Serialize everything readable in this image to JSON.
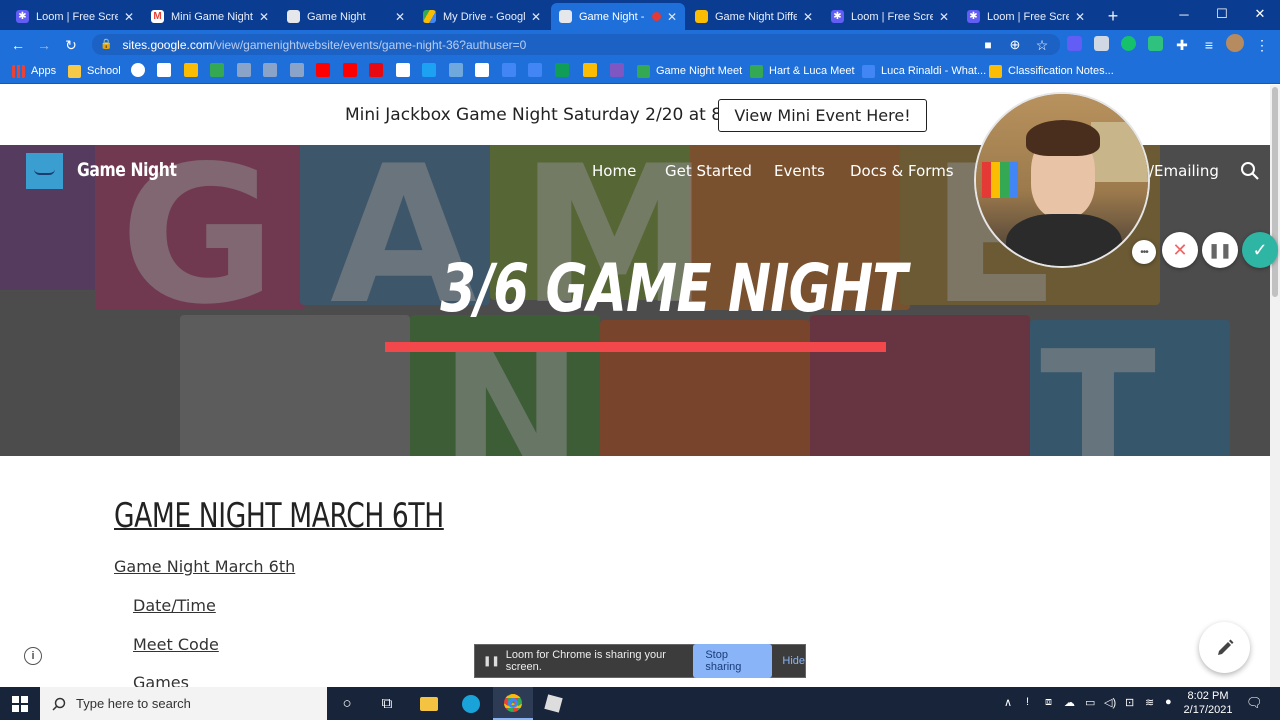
{
  "browser": {
    "tabs": [
      {
        "title": "Loom | Free Screen",
        "icon": "loom-icon",
        "color": "#625df5"
      },
      {
        "title": "Mini Game Night ·",
        "icon": "gmail-icon",
        "color": "#ea4335"
      },
      {
        "title": "Game Night",
        "icon": "sites-icon",
        "color": "#4b5563"
      },
      {
        "title": "My Drive - Google",
        "icon": "drive-icon",
        "color": "#34a853"
      },
      {
        "title": "Game Night -",
        "icon": "sites-icon",
        "color": "#4285f4",
        "active": true
      },
      {
        "title": "Game Night Differ",
        "icon": "slides-icon",
        "color": "#fbbc04"
      },
      {
        "title": "Loom | Free Screen",
        "icon": "loom-icon",
        "color": "#625df5"
      },
      {
        "title": "Loom | Free Screen",
        "icon": "loom-icon",
        "color": "#625df5"
      }
    ],
    "new_tab": "+",
    "url_host": "sites.google.com",
    "url_path": "/view/gamenightwebsite/events/game-night-36?authuser=0",
    "bookmarks": [
      {
        "label": "Apps",
        "icon": "apps-grid-icon"
      },
      {
        "label": "School",
        "icon": "folder-icon"
      },
      {
        "label": "Game Night Meet",
        "icon": "meet-icon"
      },
      {
        "label": "Hart & Luca Meet",
        "icon": "meet-icon"
      },
      {
        "label": "Luca Rinaldi - What...",
        "icon": "docs-icon"
      },
      {
        "label": "Classification Notes...",
        "icon": "slides-icon"
      }
    ]
  },
  "site": {
    "announcement": "Mini Jackbox Game Night Saturday 2/20 at 8PM!",
    "announcement_button": "View Mini Event Here!",
    "name": "Game Night",
    "nav": [
      "Home",
      "Get Started",
      "Events",
      "Docs & Forms",
      "/Emailing"
    ],
    "hero_title": "3/6 GAME NIGHT",
    "accent": "#f2484b",
    "content_title": "GAME NIGHT MARCH 6TH",
    "toc": [
      "Game Night March 6th",
      "Date/Time",
      "Meet Code",
      "Games"
    ]
  },
  "loom": {
    "share_message": "Loom for Chrome is sharing your screen.",
    "stop_label": "Stop sharing",
    "hide_label": "Hide"
  },
  "taskbar": {
    "search_placeholder": "Type here to search",
    "time": "8:02 PM",
    "date": "2/17/2021"
  }
}
